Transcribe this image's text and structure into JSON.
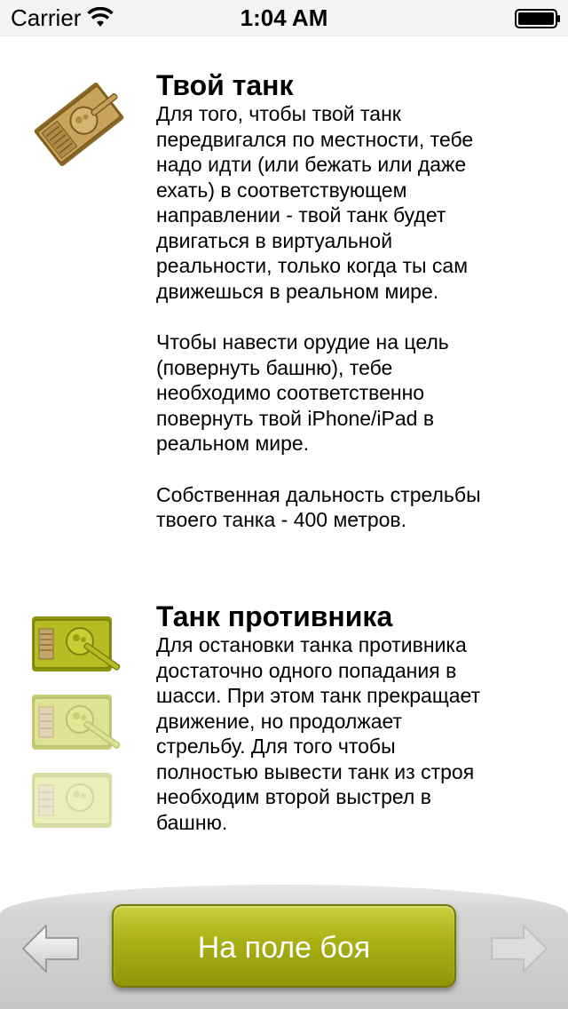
{
  "status_bar": {
    "carrier": "Carrier",
    "time": "1:04 AM"
  },
  "sections": [
    {
      "title": "Твой танк",
      "paragraphs": [
        "Для того, чтобы твой танк\nпередвигался по местности, тебе\nнадо идти (или бежать или даже\nехать) в соответствующем\nнаправлении - твой танк будет\nдвигаться в виртуальной\nреальности, только когда ты сам\nдвижешься в реальном мире.",
        "Чтобы навести орудие на цель\n(повернуть башню), тебе\nнеобходимо соответственно\nповернуть твой iPhone/iPad в\nреальном мире.",
        "Собственная дальность стрельбы\nтвоего танка - 400 метров."
      ]
    },
    {
      "title": "Танк противника",
      "paragraphs": [
        "Для остановки танка противника\nдостаточно одного попадания в\nшасси. При этом танк прекращает\nдвижение, но продолжает\nстрельбу. Для того чтобы\nполностью вывести танк из строя\nнеобходим второй выстрел в\nбашню."
      ]
    }
  ],
  "bottom": {
    "battle_button_label": "На поле боя",
    "back_icon": "left-arrow-icon",
    "forward_icon": "right-arrow-icon"
  },
  "colors": {
    "own_tank": "#b08a3c",
    "enemy_tank": "#a8b018",
    "button": "#a9b014"
  }
}
